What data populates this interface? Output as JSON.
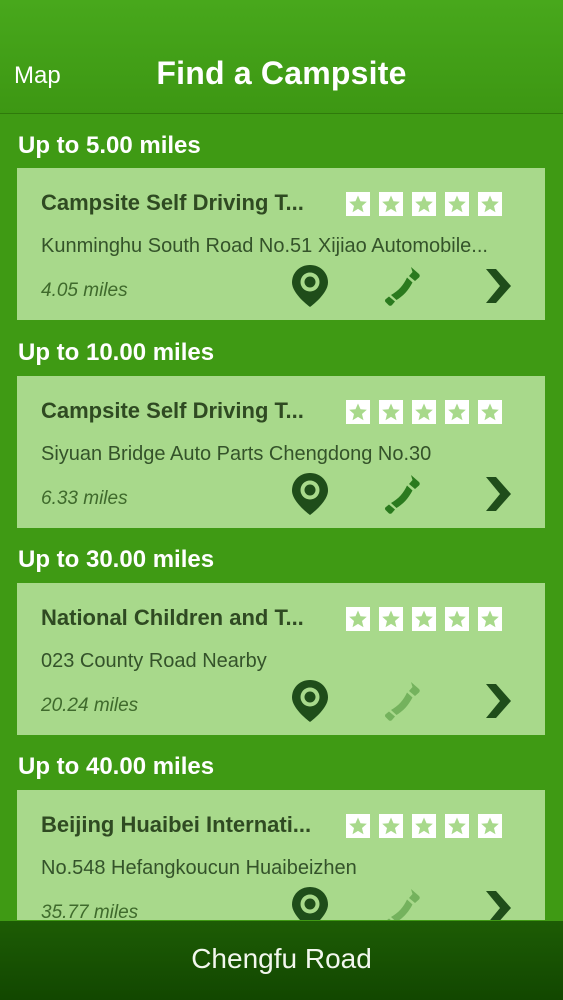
{
  "header": {
    "map_label": "Map",
    "title": "Find a Campsite"
  },
  "sections": [
    {
      "title": "Up to 5.00 miles",
      "campsite": {
        "name": "Campsite Self Driving T...",
        "address": "Kunminghu South Road No.51  Xijiao Automobile...",
        "distance": "4.05 miles",
        "stars": 5,
        "phone_enabled": true
      }
    },
    {
      "title": "Up to 10.00 miles",
      "campsite": {
        "name": "Campsite Self Driving T...",
        "address": "Siyuan Bridge Auto Parts Chengdong No.30",
        "distance": "6.33 miles",
        "stars": 5,
        "phone_enabled": true
      }
    },
    {
      "title": "Up to 30.00 miles",
      "campsite": {
        "name": "National Children and T...",
        "address": "023 County Road Nearby",
        "distance": "20.24 miles",
        "stars": 5,
        "phone_enabled": false
      }
    },
    {
      "title": "Up to 40.00 miles",
      "campsite": {
        "name": "Beijing Huaibei Internati...",
        "address": "No.548  Hefangkoucun  Huaibeizhen",
        "distance": "35.77 miles",
        "stars": 5,
        "phone_enabled": false
      }
    }
  ],
  "bottom_bar": {
    "location": "Chengfu Road"
  },
  "icons": {
    "pin": "map-pin-icon",
    "phone": "phone-icon",
    "chevron": "chevron-right-icon",
    "star": "star-icon"
  },
  "colors": {
    "background": "#3f9a14",
    "card": "#a8d98b",
    "icon_dark": "#1f4d1a",
    "phone_active": "#2a7a1e",
    "phone_disabled": "#74b25d",
    "bottom_bar": "#1a5502"
  }
}
